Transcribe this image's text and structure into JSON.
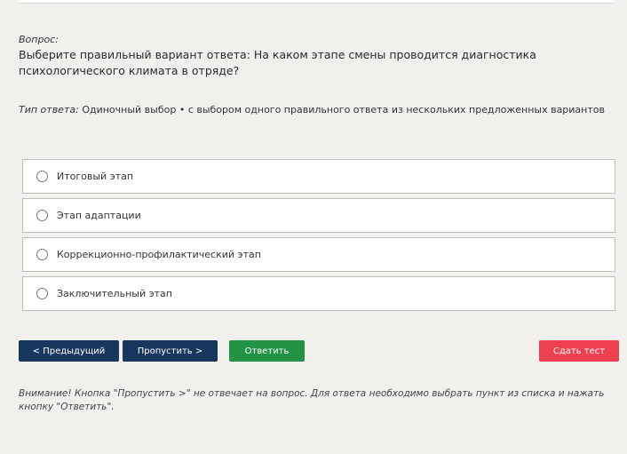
{
  "question": {
    "label": "Вопрос:",
    "text": "Выберите правильный вариант ответа: На каком этапе смены проводится диагностика психологического климата в отряде?"
  },
  "answer_type": {
    "label": "Тип ответа:",
    "value": "Одиночный выбор • с выбором одного правильного ответа из нескольких предложенных вариантов"
  },
  "options": [
    {
      "label": "Итоговый этап"
    },
    {
      "label": "Этап адаптации"
    },
    {
      "label": "Коррекционно-профилактический этап"
    },
    {
      "label": "Заключительный этап"
    }
  ],
  "buttons": {
    "prev": "< Предыдущий",
    "skip": "Пропустить >",
    "answer": "Ответить",
    "finish": "Сдать тест"
  },
  "note": "Внимание! Кнопка \"Пропустить >\" не отвечает на вопрос. Для ответа необходимо выбрать пункт из списка и нажать кнопку \"Ответить\".",
  "colors": {
    "background": "#f1f0ec",
    "nav_button": "#17375e",
    "answer_button": "#239445",
    "finish_button": "#ef4050"
  }
}
